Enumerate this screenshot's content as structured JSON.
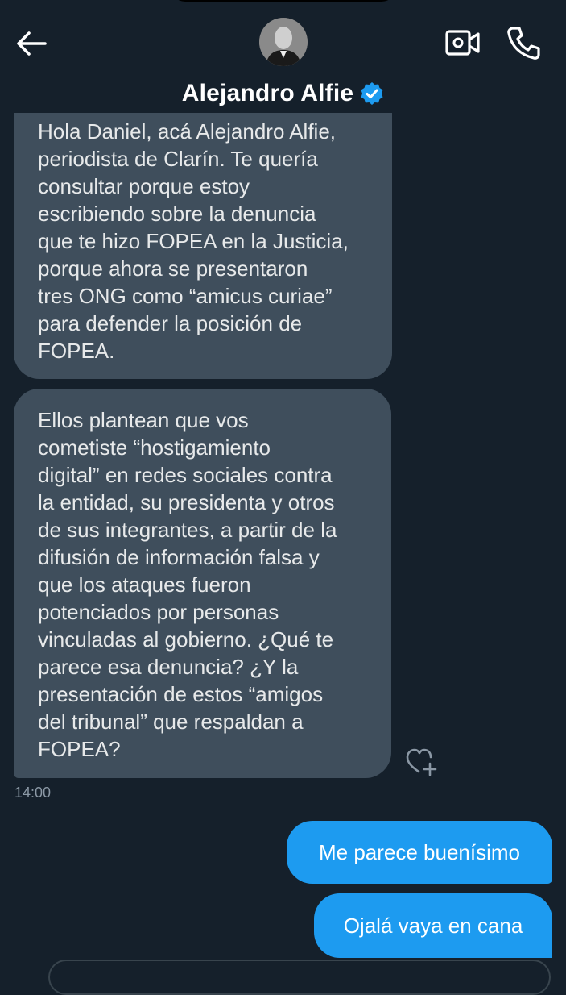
{
  "header": {
    "contact_name": "Alejandro Alfie",
    "icons": [
      "back-arrow-icon",
      "video-call-icon",
      "phone-icon",
      "verified-badge-icon"
    ],
    "verified_color": "#1d9bf0"
  },
  "messages": {
    "incoming": [
      {
        "text": "Hola Daniel, acá Alejandro Alfie,\nperiodista de Clarín. Te quería\nconsultar porque estoy\nescribiendo sobre la denuncia\nque te hizo FOPEA en la Justicia,\nporque ahora se presentaron\ntres ONG como “amicus curiae”\npara defender la posición de\nFOPEA."
      },
      {
        "text": "Ellos plantean que vos\ncometiste “hostigamiento\ndigital” en redes sociales contra\nla entidad, su presidenta y otros\nde sus integrantes, a partir de la\ndifusión de información falsa y\nque los ataques fueron\npotenciados por personas\nvinculadas al gobierno. ¿Qué te\nparece esa denuncia? ¿Y la\npresentación de estos “amigos\ndel tribunal” que respaldan a\nFOPEA?"
      }
    ],
    "timestamp": "14:00",
    "outgoing": [
      {
        "text": "Me parece buenísimo"
      },
      {
        "text": "Ojalá vaya en cana"
      }
    ]
  },
  "colors": {
    "background": "#15202b",
    "incoming_bubble": "#3f4e5c",
    "outgoing_bubble": "#1d9bf0"
  }
}
